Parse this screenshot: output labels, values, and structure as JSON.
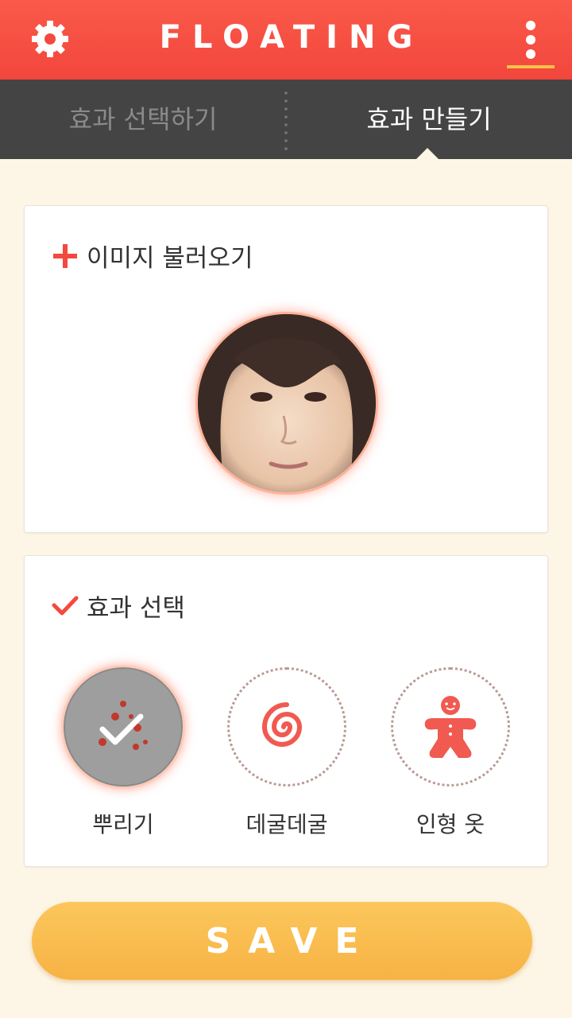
{
  "app": {
    "title": "FLOATING"
  },
  "colors": {
    "primary": "#f2463c",
    "accent": "#f7c04a",
    "tabbar": "#444444",
    "background": "#fdf5e6",
    "save": "#f8b244"
  },
  "tabs": [
    {
      "label": "효과 선택하기",
      "active": false
    },
    {
      "label": "효과 만들기",
      "active": true
    }
  ],
  "image_card": {
    "label": "이미지 불러오기",
    "icon": "plus-icon"
  },
  "effect_card": {
    "label": "효과 선택",
    "icon": "check-icon",
    "effects": [
      {
        "label": "뿌리기",
        "icon": "sprinkle-icon",
        "selected": true
      },
      {
        "label": "데굴데굴",
        "icon": "spiral-icon",
        "selected": false
      },
      {
        "label": "인형 옷",
        "icon": "gingerbread-icon",
        "selected": false
      }
    ]
  },
  "save": {
    "label": "SAVE"
  }
}
